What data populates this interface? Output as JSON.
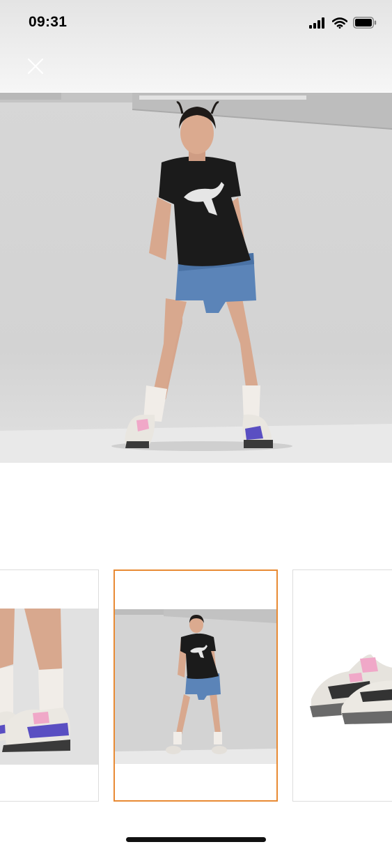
{
  "status_bar": {
    "time": "09:31"
  },
  "icons": {
    "signal": "cellular-signal-icon",
    "wifi": "wifi-icon",
    "battery": "battery-icon",
    "close": "close-icon"
  },
  "colors": {
    "selected_border": "#e88a33",
    "thumbnail_border": "#dcdcdc"
  },
  "gallery": {
    "thumbnails": [
      {
        "subject": "legs-and-sneakers"
      },
      {
        "subject": "full-body-model",
        "selected": true
      },
      {
        "subject": "sneaker-pair"
      }
    ]
  }
}
